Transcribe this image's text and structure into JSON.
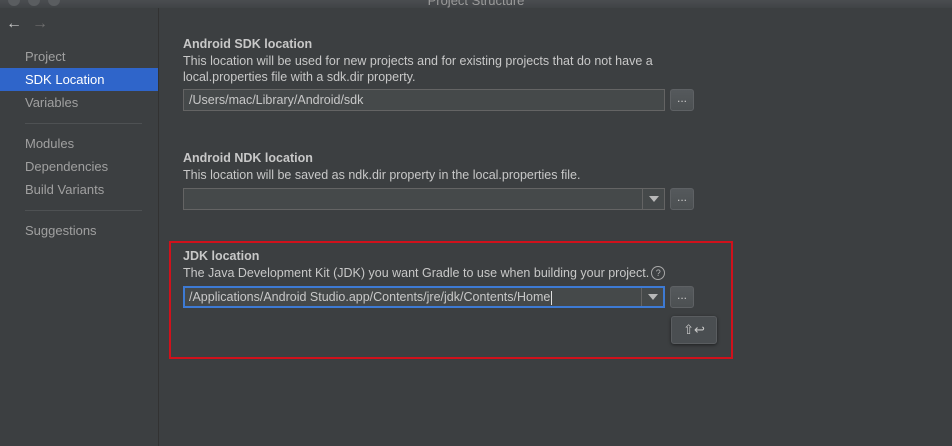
{
  "window": {
    "title": "Project Structure",
    "nav_back": "←",
    "nav_forward": "→"
  },
  "sidebar": {
    "items": [
      {
        "label": "Project"
      },
      {
        "label": "SDK Location",
        "selected": true
      },
      {
        "label": "Variables"
      },
      {
        "label": "Modules"
      },
      {
        "label": "Dependencies"
      },
      {
        "label": "Build Variants"
      },
      {
        "label": "Suggestions"
      }
    ]
  },
  "sdk": {
    "title": "Android SDK location",
    "desc_line1": "This location will be used for new projects and for existing projects that do not have a",
    "desc_line2": "local.properties file with a sdk.dir property.",
    "path": "/Users/mac/Library/Android/sdk",
    "browse_label": "..."
  },
  "ndk": {
    "title": "Android NDK location",
    "desc": "This location will be saved as ndk.dir property in the local.properties file.",
    "path": "",
    "browse_label": "..."
  },
  "jdk": {
    "title": "JDK location",
    "desc": "The Java Development Kit (JDK) you want Gradle to use when building your project.",
    "help_glyph": "?",
    "path": "/Applications/Android Studio.app/Contents/jre/jdk/Contents/Home",
    "browse_label": "...",
    "shortcut_hint": "⇧↩"
  },
  "colors": {
    "selection": "#2f65ca",
    "focus_border": "#3d7ad4",
    "annotation_red": "#d0111b",
    "background": "#3c3f41"
  },
  "icons": {
    "back": "arrow-left-icon",
    "forward": "arrow-right-icon",
    "dropdown": "chevron-down-icon",
    "help": "help-icon",
    "shift_enter": "shift-enter-icon"
  }
}
